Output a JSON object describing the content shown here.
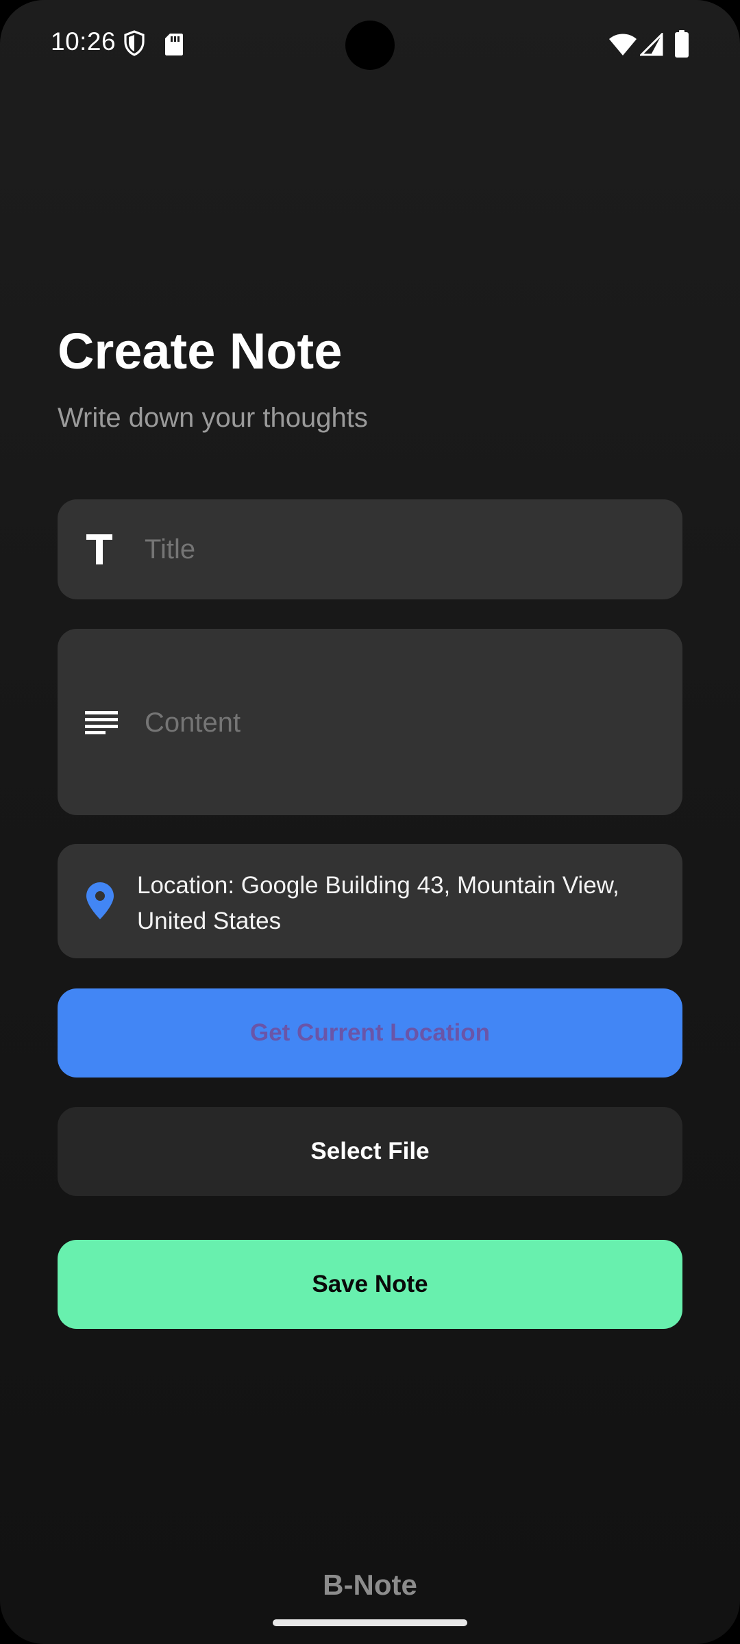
{
  "status_bar": {
    "time": "10:26",
    "icons": [
      "shield-icon",
      "sd-card-icon",
      "wifi-icon",
      "signal-icon",
      "battery-icon"
    ]
  },
  "header": {
    "title": "Create Note",
    "subtitle": "Write down your thoughts"
  },
  "form": {
    "title_placeholder": "Title",
    "content_placeholder": "Content",
    "location_text": "Location: Google Building 43, Mountain View, United States"
  },
  "buttons": {
    "get_location": "Get Current Location",
    "select_file": "Select File",
    "save_note": "Save Note"
  },
  "footer": {
    "brand": "B-Note"
  },
  "colors": {
    "accent_blue": "#4286f5",
    "save_green": "#68f0ae",
    "location_label_purple": "#6a55a8"
  }
}
